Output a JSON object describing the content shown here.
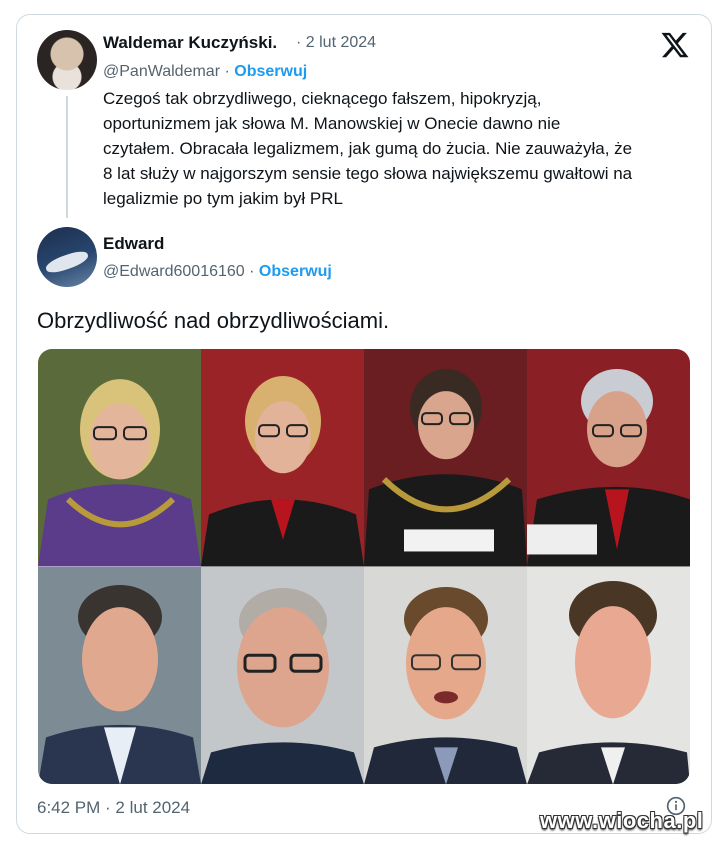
{
  "reply_tweet": {
    "author_name": "Waldemar Kuczyński.",
    "date": "· 2 lut 2024",
    "handle": "@PanWaldemar",
    "separator": "·",
    "follow_label": "Obserwuj",
    "text_lines": [
      "Czegoś tak obrzydliwego, cieknącego fałszem, hipokryzją,",
      "oportunizmem jak słowa M. Manowskiej w Onecie dawno nie",
      "czytałem. Obracała legalizmem, jak gumą do żucia. Nie zauważyła, że",
      "8 lat służy w najgorszym sensie tego słowa największemu gwałtowi na",
      "legalizmie po tym jakim był PRL"
    ]
  },
  "main_tweet": {
    "author_name": "Edward",
    "handle": "@Edward60016160",
    "separator": "·",
    "follow_label": "Obserwuj",
    "text": "Obrzydliwość nad obrzydliwościami.",
    "timestamp": "6:42 PM · 2 lut 2024"
  },
  "icons": {
    "platform_logo": "x-logo-icon",
    "info": "info-icon"
  },
  "colors": {
    "follow": "#1d9bf0",
    "secondary_text": "#536471",
    "border": "#cfd9de"
  },
  "watermark": "www.wiocha.pl"
}
